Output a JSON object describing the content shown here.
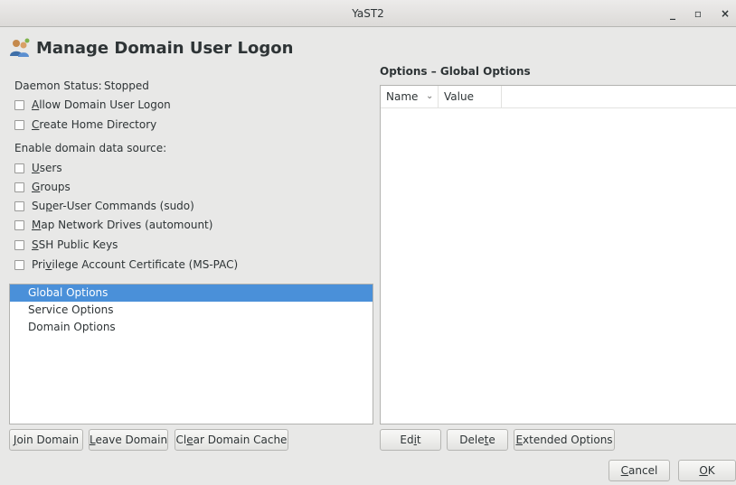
{
  "window": {
    "title": "YaST2",
    "minimize_glyph": "_",
    "maximize_glyph": "▫",
    "close_glyph": "×"
  },
  "page": {
    "title": "Manage Domain User Logon",
    "icon": "users-network-icon"
  },
  "daemon_status": {
    "label": "Daemon Status:",
    "value": "Stopped"
  },
  "options": [
    {
      "pre": "",
      "u": "A",
      "post": "llow Domain User Logon",
      "checked": false
    },
    {
      "pre": "",
      "u": "C",
      "post": "reate Home Directory",
      "checked": false
    }
  ],
  "data_source": {
    "heading": "Enable domain data source:",
    "items": [
      {
        "pre": "",
        "u": "U",
        "post": "sers",
        "checked": false
      },
      {
        "pre": "",
        "u": "G",
        "post": "roups",
        "checked": false
      },
      {
        "pre": "Su",
        "u": "p",
        "post": "er-User Commands (sudo)",
        "checked": false
      },
      {
        "pre": "",
        "u": "M",
        "post": "ap Network Drives (automount)",
        "checked": false
      },
      {
        "pre": "",
        "u": "S",
        "post": "SH Public Keys",
        "checked": false
      },
      {
        "pre": "Pri",
        "u": "v",
        "post": "ilege Account Certificate (MS-PAC)",
        "checked": false
      }
    ]
  },
  "sections": [
    "Global Options",
    "Service Options",
    "Domain Options"
  ],
  "selected_section": "Global Options",
  "options_panel": {
    "title": "Options – Global Options",
    "columns": [
      "Name",
      "Value"
    ],
    "rows": []
  },
  "left_buttons": [
    {
      "pre": "",
      "u": "J",
      "post": "oin Domain"
    },
    {
      "pre": "",
      "u": "L",
      "post": "eave Domain"
    },
    {
      "pre": "Cl",
      "u": "e",
      "post": "ar Domain Cache"
    }
  ],
  "right_buttons": [
    {
      "pre": "Ed",
      "u": "i",
      "post": "t"
    },
    {
      "pre": "Dele",
      "u": "t",
      "post": "e"
    },
    {
      "pre": "",
      "u": "E",
      "post": "xtended Options"
    }
  ],
  "dialog_buttons": {
    "cancel": {
      "pre": "",
      "u": "C",
      "post": "ancel"
    },
    "ok": {
      "pre": "",
      "u": "O",
      "post": "K"
    }
  },
  "colors": {
    "selection": "#4a90d9",
    "background": "#e8e8e7"
  }
}
